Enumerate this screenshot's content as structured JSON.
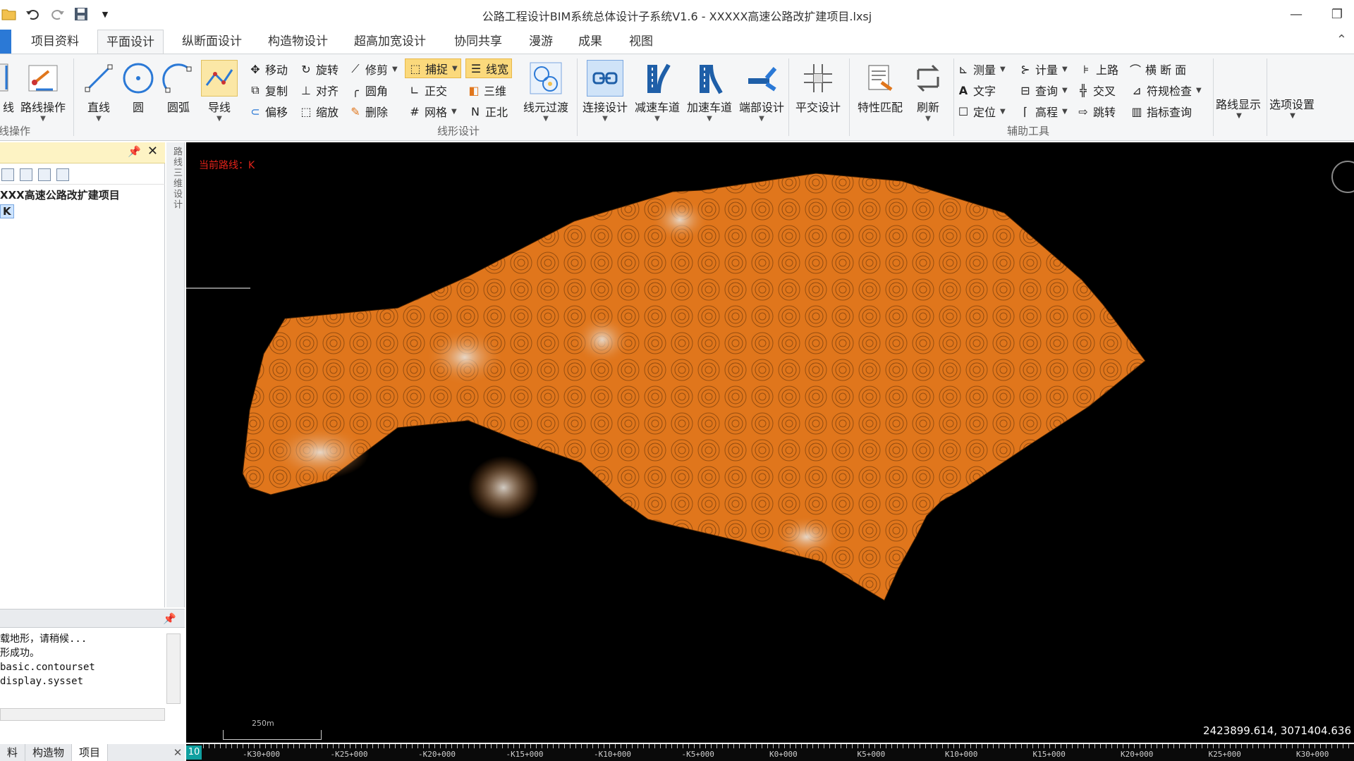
{
  "window": {
    "title": "公路工程设计BIM系统总体设计子系统V1.6 - XXXXX高速公路改扩建项目.lxsj"
  },
  "quick_access": [
    "open-icon",
    "undo-icon",
    "redo-icon",
    "save-icon",
    "customize-caret-icon"
  ],
  "tabs": [
    {
      "label": "项目资料"
    },
    {
      "label": "平面设计",
      "active": true
    },
    {
      "label": "纵断面设计"
    },
    {
      "label": "构造物设计"
    },
    {
      "label": "超高加宽设计"
    },
    {
      "label": "协同共享"
    },
    {
      "label": "漫游"
    },
    {
      "label": "成果"
    },
    {
      "label": "视图"
    }
  ],
  "ribbon": {
    "group_route_ops": {
      "label": "线操作",
      "btn_partial": "线",
      "btn_route_ops": "路线操作"
    },
    "group_line_design": {
      "label": "线形设计",
      "line": "直线",
      "circle": "圆",
      "arc": "圆弧",
      "guide": "导线",
      "move": "移动",
      "rotate": "旋转",
      "trim": "修剪",
      "snap": "捕捉",
      "linewidth": "线宽",
      "copy": "复制",
      "align": "对齐",
      "fillet": "圆角",
      "ortho": "正交",
      "three_d": "三维",
      "offset": "偏移",
      "scale": "缩放",
      "delete": "删除",
      "grid": "网格",
      "north": "正北",
      "transition": "线元过渡"
    },
    "connect": "连接设计",
    "decel": "减速车道",
    "accel": "加速车道",
    "end": "端部设计",
    "flat_cross": "平交设计",
    "match": "特性匹配",
    "refresh": "刷新",
    "group_aux": {
      "label": "辅助工具",
      "measure": "测量",
      "calc": "计量",
      "onroad": "上路",
      "cross_section": "横 断 面",
      "text": "文字",
      "query": "查询",
      "intersect": "交叉",
      "compliance": "符规检查",
      "locate": "定位",
      "elevation": "高程",
      "jump": "跳转",
      "index_query": "指标查询"
    },
    "route_display": "路线显示",
    "options": "选项设置"
  },
  "project_panel": {
    "root": "XXX高速公路改扩建项目",
    "child": "K",
    "side_label": "路线三维设计"
  },
  "command_panel": {
    "lines": [
      "载地形，请稍候...",
      "形成功。",
      "basic.contourset",
      "display.sysset"
    ]
  },
  "bottom_tabs": [
    "料",
    "构造物",
    "项目"
  ],
  "viewport": {
    "current_route": "当前路线：K",
    "coords": "2423899.614, 3071404.636",
    "scale_label": "250m",
    "terrain_color": "#e0761c"
  },
  "ruler": {
    "zoom": "10",
    "ticks": [
      "-K30+000",
      "-K25+000",
      "-K20+000",
      "-K15+000",
      "-K10+000",
      "-K5+000",
      "K0+000",
      "K5+000",
      "K10+000",
      "K15+000",
      "K20+000",
      "K25+000",
      "K30+000"
    ]
  }
}
